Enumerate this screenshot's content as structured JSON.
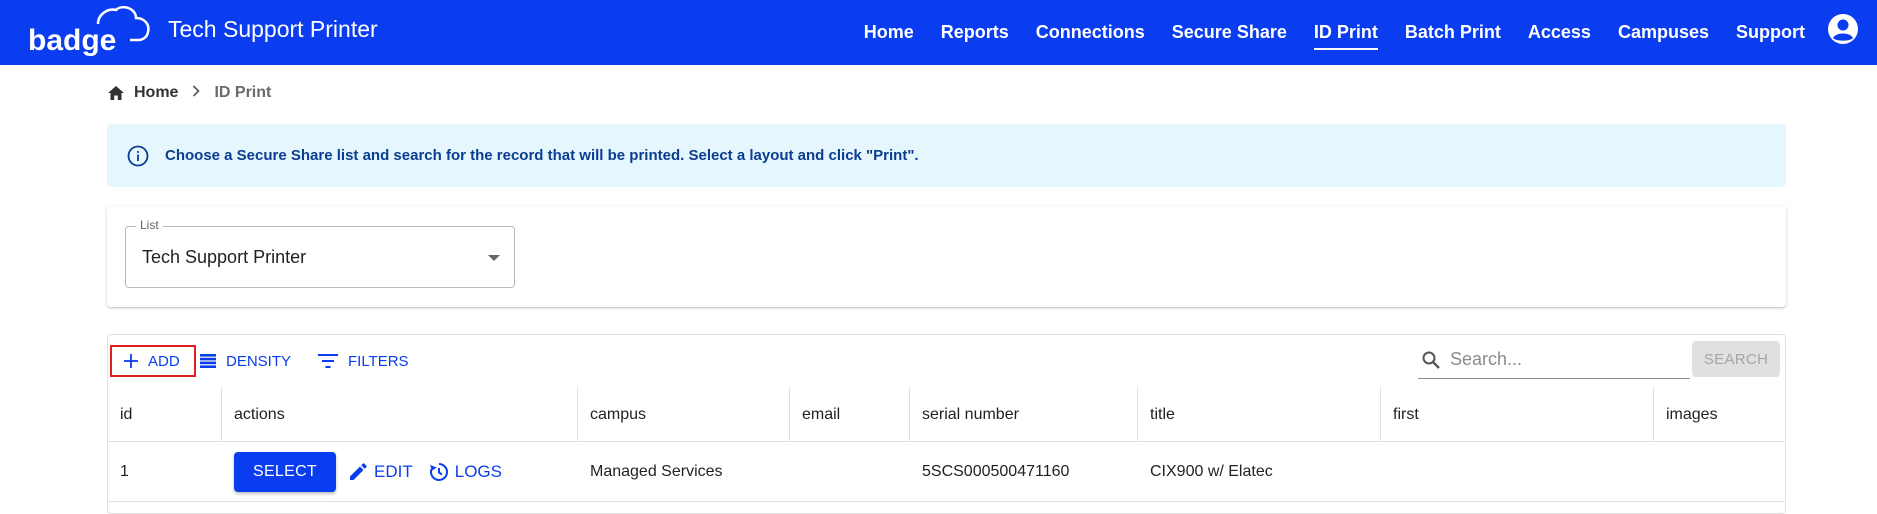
{
  "header": {
    "brand": "badge",
    "app_title": "Tech Support Printer",
    "nav": [
      {
        "label": "Home",
        "active": false
      },
      {
        "label": "Reports",
        "active": false
      },
      {
        "label": "Connections",
        "active": false
      },
      {
        "label": "Secure Share",
        "active": false
      },
      {
        "label": "ID Print",
        "active": true
      },
      {
        "label": "Batch Print",
        "active": false
      },
      {
        "label": "Access",
        "active": false
      },
      {
        "label": "Campuses",
        "active": false
      },
      {
        "label": "Support",
        "active": false
      }
    ],
    "account_icon": "account-circle-icon"
  },
  "breadcrumb": {
    "home": "Home",
    "current": "ID Print"
  },
  "alert": {
    "icon": "info-icon",
    "message": "Choose a Secure Share list and search for the record that will be printed. Select a layout and click \"Print\"."
  },
  "list_select": {
    "label": "List",
    "value": "Tech Support Printer"
  },
  "toolbar": {
    "add_label": "ADD",
    "density_label": "DENSITY",
    "filters_label": "FILTERS",
    "search_placeholder": "Search...",
    "search_button": "SEARCH"
  },
  "table": {
    "columns": [
      "id",
      "actions",
      "campus",
      "email",
      "serial number",
      "title",
      "first",
      "images"
    ],
    "rows": [
      {
        "id": "1",
        "select_label": "SELECT",
        "edit_label": "EDIT",
        "logs_label": "LOGS",
        "campus": "Managed Services",
        "email": "",
        "serial_number": "5SCS000500471160",
        "title": "CIX900 w/ Elatec",
        "first": "",
        "images": ""
      }
    ]
  },
  "colors": {
    "primary": "#0a3cf0",
    "alert_bg": "#e5f6fd",
    "alert_text": "#0b3d91",
    "highlight_border": "#e02020"
  }
}
